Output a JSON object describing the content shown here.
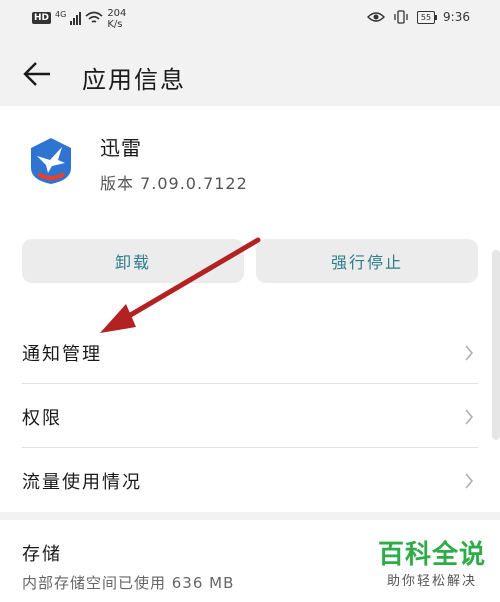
{
  "status_bar": {
    "hd": "HD",
    "network": "4G",
    "speed_value": "204",
    "speed_unit": "K/s",
    "battery": "55",
    "time": "9:36",
    "icons": [
      "signal-icon",
      "wifi-icon",
      "eye-icon",
      "vibrate-icon",
      "battery-icon"
    ]
  },
  "header": {
    "title": "应用信息",
    "back_icon": "arrow-left-icon"
  },
  "app": {
    "name": "迅雷",
    "version": "版本 7.09.0.7122",
    "icon": "xunlei-bird-icon"
  },
  "actions": {
    "uninstall_label": "卸载",
    "force_stop_label": "强行停止"
  },
  "list": {
    "items": [
      {
        "label": "通知管理"
      },
      {
        "label": "权限"
      },
      {
        "label": "流量使用情况"
      }
    ]
  },
  "storage": {
    "title": "存储",
    "detail": "内部存储空间已使用 636 MB"
  },
  "watermark": {
    "main": "百科全说",
    "sub": "助你轻松解决"
  },
  "colors": {
    "accent": "#2e7d8a",
    "annotation_arrow": "#b22222",
    "watermark_green": "#2eac4a"
  }
}
